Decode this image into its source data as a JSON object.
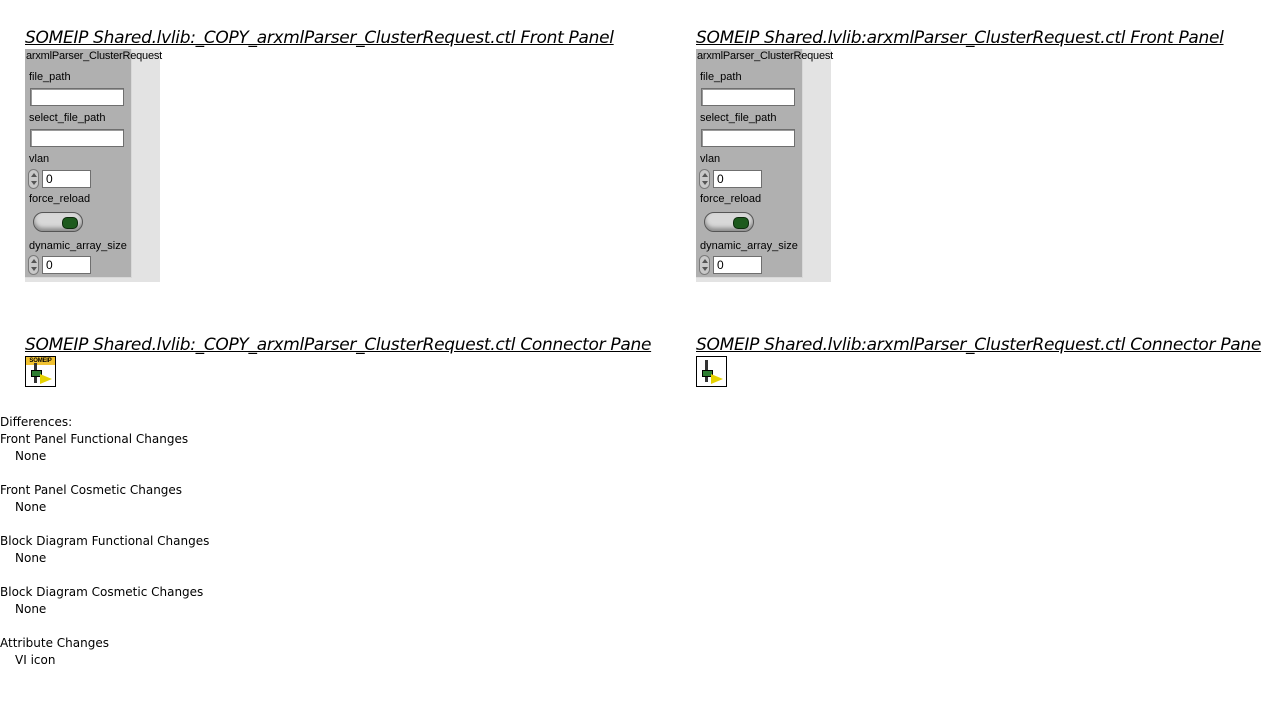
{
  "left": {
    "front_panel_heading": "SOMEIP Shared.lvlib:_COPY_arxmlParser_ClusterRequest.ctl Front Panel",
    "connector_heading": "SOMEIP Shared.lvlib:_COPY_arxmlParser_ClusterRequest.ctl Connector Pane",
    "icon_banner": "SOMEIP"
  },
  "right": {
    "front_panel_heading": "SOMEIP Shared.lvlib:arxmlParser_ClusterRequest.ctl Front Panel",
    "connector_heading": "SOMEIP Shared.lvlib:arxmlParser_ClusterRequest.ctl Connector Pane"
  },
  "cluster": {
    "label": "arxmlParser_ClusterRequest",
    "file_path_label": "file_path",
    "select_file_path_label": "select_file_path",
    "vlan_label": "vlan",
    "vlan_value": "0",
    "force_reload_label": "force_reload",
    "dynamic_array_size_label": "dynamic_array_size",
    "dynamic_array_size_value": "0"
  },
  "differences": {
    "title": "Differences:",
    "sections": [
      {
        "heading": "Front Panel Functional Changes",
        "value": "None"
      },
      {
        "heading": "Front Panel Cosmetic Changes",
        "value": "None"
      },
      {
        "heading": "Block Diagram Functional Changes",
        "value": "None"
      },
      {
        "heading": "Block Diagram Cosmetic Changes",
        "value": "None"
      },
      {
        "heading": "Attribute Changes",
        "value": "VI icon"
      }
    ]
  }
}
